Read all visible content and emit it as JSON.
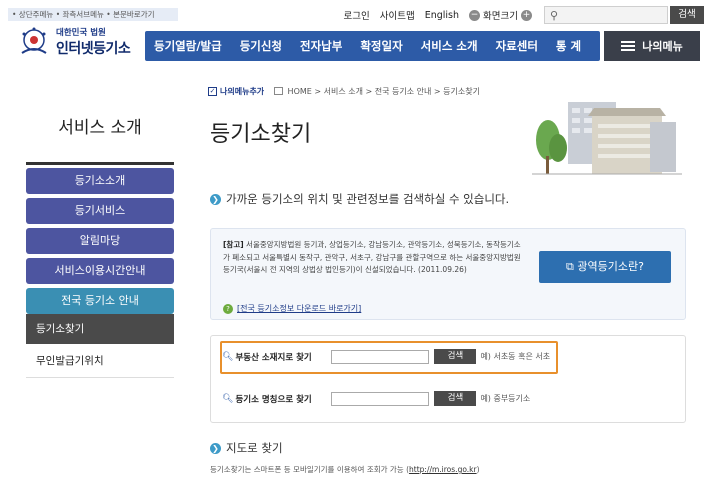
{
  "skip_links": "• 상단주메뉴 • 좌측서브메뉴 • 본문바로가기",
  "util": {
    "login": "로그인",
    "sitemap": "사이트맵",
    "english": "English",
    "zoom_label": "화면크기",
    "zoom_minus": "−",
    "zoom_plus": "+",
    "search_button": "검색"
  },
  "logo": {
    "line1": "대한민국 법원",
    "line2": "인터넷등기소"
  },
  "nav": [
    "등기열람/발급",
    "등기신청",
    "전자납부",
    "확정일자",
    "서비스 소개",
    "자료센터",
    "통 계"
  ],
  "mymenu": "나의메뉴",
  "sidebar": {
    "title": "서비스 소개",
    "items": [
      {
        "label": "등기소소개"
      },
      {
        "label": "등기서비스"
      },
      {
        "label": "알림마당"
      },
      {
        "label": "서비스이용시간안내"
      },
      {
        "label": "전국 등기소 안내"
      }
    ],
    "subs": [
      {
        "label": "등기소찾기"
      },
      {
        "label": "무인발급기위치"
      }
    ]
  },
  "breadcrumb": {
    "add_menu": "나의메뉴추가",
    "path": "HOME > 서비스 소개 > 전국 등기소 안내 > 등기소찾기"
  },
  "page_title": "등기소찾기",
  "intro": "가까운 등기소의 위치 및 관련정보를 검색하실 수 있습니다.",
  "notice": {
    "tag": "[참고]",
    "text": " 서울중앙지방법원 등기과, 상업등기소, 강남등기소, 관악등기소, 성북등기소, 동작등기소가 폐소되고 서울특별시 동작구, 관악구, 서초구, 강남구를 관할구역으로 하는 서울중앙지방법원 등기국(서울시 전 지역의 상법상 법인등기)이 신설되었습니다. (2011.09.26)",
    "link": "[전국 등기소정보 다운로드 바로가기]",
    "wide_button": "광역등기소란?"
  },
  "search": {
    "row1": {
      "label": "부동산 소재지로 찾기",
      "button": "검색",
      "hint": "예) 서초동 혹은 서초"
    },
    "row2": {
      "label": "등기소 명칭으로 찾기",
      "button": "검색",
      "hint": "예) 중부등기소"
    }
  },
  "map": {
    "title": "지도로 찾기",
    "desc": "등기소찾기는 스마트폰 등 모바일기기를 이용하여 조회가 가능 (",
    "url": "http://m.iros.go.kr",
    "desc_end": ")"
  }
}
